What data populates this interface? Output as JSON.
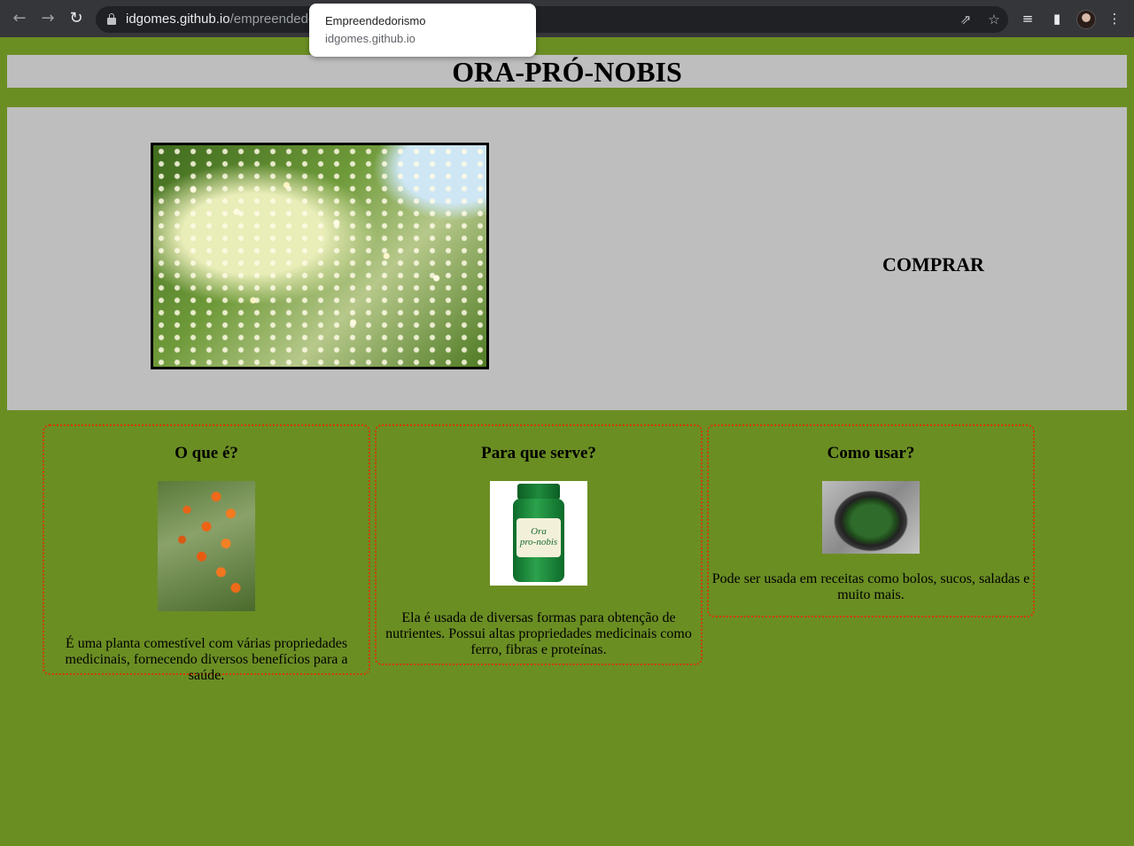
{
  "browser": {
    "url_domain": "idgomes.github.io",
    "url_path": "/empreendedor",
    "tooltip": {
      "title": "Empreendedorismo",
      "url": "idgomes.github.io"
    },
    "icons": {
      "back": "arrow-left-icon",
      "forward": "arrow-right-icon",
      "reload": "reload-icon",
      "lock": "lock-icon",
      "share": "share-icon",
      "bookmark": "star-icon",
      "media": "media-queue-icon",
      "sidepanel": "side-panel-icon",
      "profile": "avatar",
      "menu": "kebab-menu-icon"
    }
  },
  "page": {
    "title": "ORA-PRÓ-NOBIS",
    "buy_label": "COMPRAR",
    "cards": [
      {
        "heading": "O que é?",
        "text": "É uma planta comestível com várias propriedades medicinais, fornecendo diversos benefícios para a saúde."
      },
      {
        "heading": "Para que serve?",
        "text": "Ela é usada de diversas formas para obtenção de nutrientes. Possui altas propriedades medicinais como ferro, fibras e proteínas.",
        "image_text": [
          "Ora",
          "pro-nobis"
        ]
      },
      {
        "heading": "Como usar?",
        "text": "Pode ser usada em receitas como bolos, sucos, saladas e muito mais."
      }
    ]
  },
  "colors": {
    "background": "#6b8e23",
    "panel": "#bebebe",
    "card_border": "#d43a00"
  }
}
